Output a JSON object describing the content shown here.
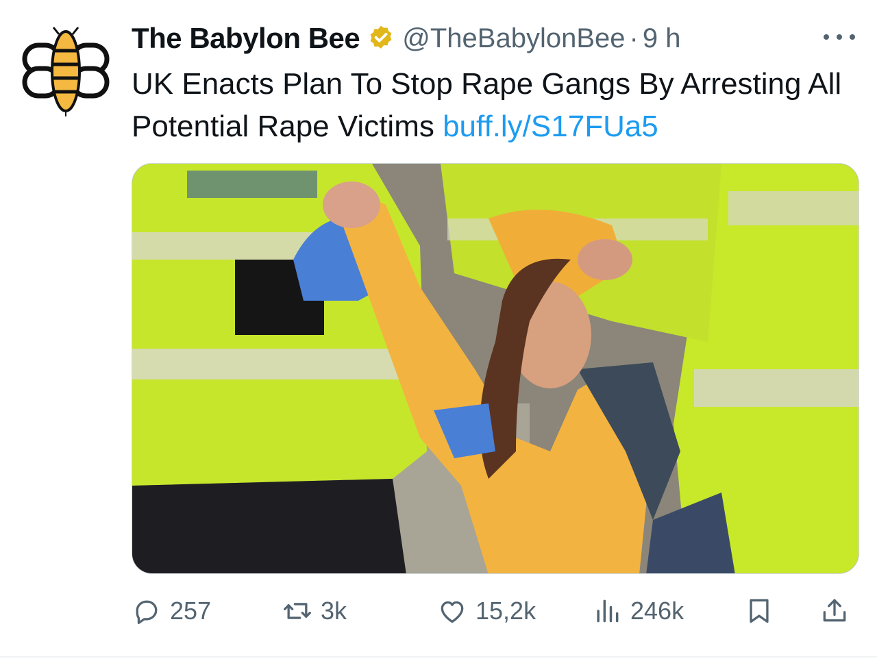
{
  "tweet": {
    "display_name": "The Babylon Bee",
    "handle": "@TheBabylonBee",
    "separator": "·",
    "time": "9 h",
    "text": "UK Enacts Plan To Stop Rape Gangs By Arresting All Potential Rape Victims ",
    "link": "buff.ly/S17FUa5",
    "avatar_icon": "babylon-bee-logo",
    "verified_icon": "gold-verified-badge",
    "more_icon": "ellipsis-icon"
  },
  "actions": {
    "reply": {
      "icon": "reply-icon",
      "count": "257"
    },
    "retweet": {
      "icon": "retweet-icon",
      "count": "3k"
    },
    "like": {
      "icon": "heart-icon",
      "count": "15,2k"
    },
    "views": {
      "icon": "views-icon",
      "count": "246k"
    },
    "bookmark": {
      "icon": "bookmark-icon"
    },
    "share": {
      "icon": "share-icon"
    }
  },
  "colors": {
    "text": "#0f1419",
    "secondary": "#536471",
    "link": "#1d9bf0",
    "verified_gold": "#e2b719",
    "bee_yellow": "#f5b841"
  }
}
